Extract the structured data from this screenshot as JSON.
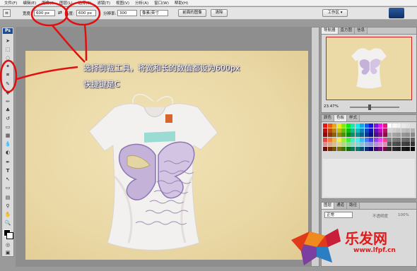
{
  "menu": {
    "items": [
      "文件(F)",
      "编辑(E)",
      "图像(I)",
      "图层(L)",
      "选择(S)",
      "滤镜(T)",
      "视图(V)",
      "分析(A)",
      "窗口(W)",
      "帮助(H)"
    ]
  },
  "options": {
    "width_label": "宽度:",
    "width_value": "600 px",
    "height_label": "高度:",
    "height_value": "600 px",
    "resolution_label": "分辨率:",
    "resolution_value": "300",
    "unit_value": "像素/英寸",
    "front_image_button": "前面的图像",
    "clear_button": "清除",
    "workspace_label": "工作区"
  },
  "panels": {
    "navigator_tabs": [
      "导航器",
      "直方图",
      "信息"
    ],
    "zoom_value": "23.47%",
    "color_tabs": [
      "颜色",
      "色板",
      "样式"
    ],
    "layers_tabs": [
      "图层",
      "通道",
      "路径"
    ],
    "blend_mode": "正常",
    "opacity_label": "不透明度",
    "opacity_value": "100%"
  },
  "annotation": {
    "line1": "选择剪裁工具，将宽和长的数值都设为600px",
    "line2": "快捷键是C"
  },
  "watermark": {
    "brand": "乐发网",
    "url": "www.lfpf.cn"
  },
  "colors": {
    "annotation_red": "#e01010",
    "canvas_background": "#ebd9a6"
  }
}
